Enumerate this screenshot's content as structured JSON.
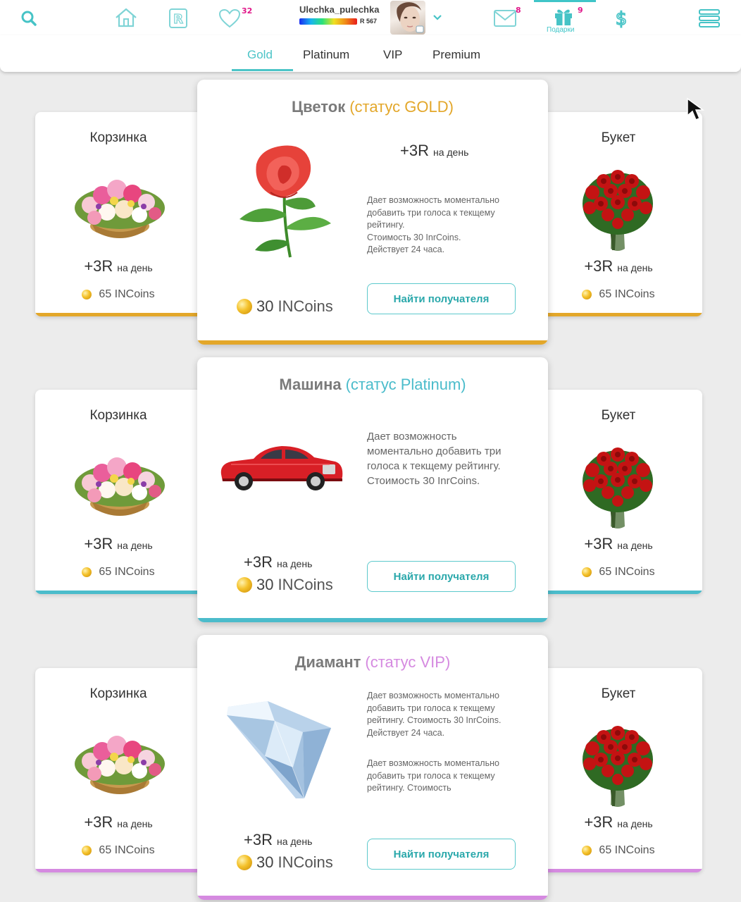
{
  "header": {
    "username": "Ulechka_pulechka",
    "rating_label": "R 567",
    "likes_badge": "32",
    "messages_badge": "8",
    "gifts_badge": "9",
    "gifts_label": "Подарки",
    "icons": [
      "search-icon",
      "home-icon",
      "rating-icon",
      "heart-icon",
      "chevron-down-icon",
      "envelope-icon",
      "gift-icon",
      "dollar-icon",
      "menu-icon"
    ]
  },
  "tabs": [
    {
      "label": "Gold"
    },
    {
      "label": "Platinum"
    },
    {
      "label": "VIP"
    },
    {
      "label": "Premium"
    }
  ],
  "colors": {
    "accent": "#4cc4c7",
    "gold": "#e3a72a",
    "platinum": "#4bbccb",
    "vip": "#d58ae0"
  },
  "rows": [
    {
      "left": {
        "title": "Корзинка",
        "points": "+3R",
        "per_day": "на день",
        "price": "65",
        "currency": "INCoins"
      },
      "right": {
        "title": "Букет",
        "points": "+3R",
        "per_day": "на день",
        "price": "65",
        "currency": "INCoins"
      },
      "center": {
        "name": "Цветок",
        "status": "(статус  GOLD)",
        "points": "+3R",
        "per_day": "на день",
        "desc_lines": [
          "Дает возможность моментально",
          "добавить три голоса к текщему",
          "рейтингу.",
          "Стоимость 30 InrCoins.",
          "Действует 24 часа."
        ],
        "price": "30",
        "currency": "INCoins",
        "button": "Найти получателя"
      }
    },
    {
      "left": {
        "title": "Корзинка",
        "points": "+3R",
        "per_day": "на день",
        "price": "65",
        "currency": "INCoins"
      },
      "right": {
        "title": "Букет",
        "points": "+3R",
        "per_day": "на день",
        "price": "65",
        "currency": "INCoins"
      },
      "center": {
        "name": "Машина",
        "status": "(статус  Platinum)",
        "points": "+3R",
        "per_day": "на день",
        "desc_lines": [
          "Дает возможность",
          "моментально добавить три",
          "голоса к текщему рейтингу.",
          "Стоимость 30 InrCoins."
        ],
        "price": "30",
        "currency": "INCoins",
        "button": "Найти получателя"
      }
    },
    {
      "left": {
        "title": "Корзинка",
        "points": "+3R",
        "per_day": "на день",
        "price": "65",
        "currency": "INCoins"
      },
      "right": {
        "title": "Букет",
        "points": "+3R",
        "per_day": "на день",
        "price": "65",
        "currency": "INCoins"
      },
      "center": {
        "name": "Диамант",
        "status": "(статус  VIP)",
        "points": "+3R",
        "per_day": "на день",
        "desc_lines": [
          "Дает возможность моментально",
          "добавить три голоса к текщему",
          "рейтингу. Стоимость 30 InrCoins.",
          "Действует 24 часа."
        ],
        "desc2_lines": [
          "Дает возможность моментально",
          "добавить три голоса к текщему",
          "рейтингу. Стоимость"
        ],
        "price": "30",
        "currency": "INCoins",
        "button": "Найти получателя"
      }
    }
  ]
}
